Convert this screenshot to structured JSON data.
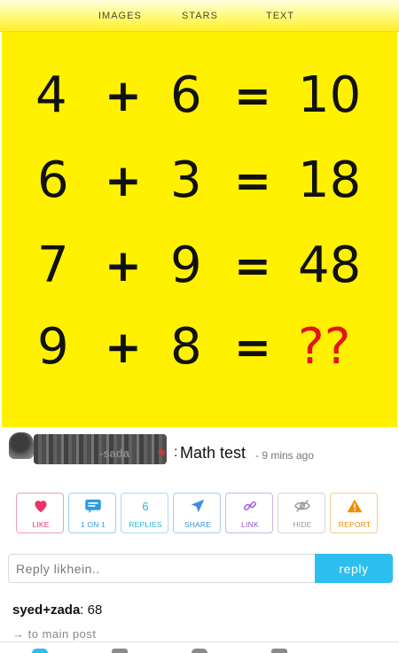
{
  "tabs": [
    "IMAGES",
    "STARS",
    "TEXT"
  ],
  "puzzle": {
    "rows": [
      {
        "a": "4",
        "op": "+",
        "b": "6",
        "eq": "=",
        "r": "10"
      },
      {
        "a": "6",
        "op": "+",
        "b": "3",
        "eq": "=",
        "r": "18"
      },
      {
        "a": "7",
        "op": "+",
        "b": "9",
        "eq": "=",
        "r": "48"
      },
      {
        "a": "9",
        "op": "+",
        "b": "8",
        "eq": "=",
        "r": "??"
      }
    ]
  },
  "post": {
    "author_fragment": "-sada",
    "separator": ":",
    "title": "Math test",
    "time": "- 9 mins ago"
  },
  "actions": [
    {
      "label": "LIKE",
      "icon": "heart-icon",
      "color": "#e8336b"
    },
    {
      "label": "1 ON 1",
      "icon": "chat-icon",
      "color": "#2c9be6"
    },
    {
      "label": "REPLIES",
      "icon": "6",
      "color": "#2bb3d6"
    },
    {
      "label": "SHARE",
      "icon": "send-icon",
      "color": "#3a8fe0"
    },
    {
      "label": "LINK",
      "icon": "link-icon",
      "color": "#9b4fd6"
    },
    {
      "label": "HIDE",
      "icon": "eye-off-icon",
      "color": "#9a9a9a"
    },
    {
      "label": "REPORT",
      "icon": "warning-icon",
      "color": "#f08c00"
    }
  ],
  "reply": {
    "placeholder": "Reply likhein..",
    "button": "reply"
  },
  "comment": {
    "user": "syed+zada",
    "sep": ":",
    "text": " 68"
  },
  "back_link": "→ to main post",
  "colors": {
    "puzzle_bg": "#fff100",
    "reply_button": "#2dbef0",
    "question_marks": "#e3141b"
  }
}
